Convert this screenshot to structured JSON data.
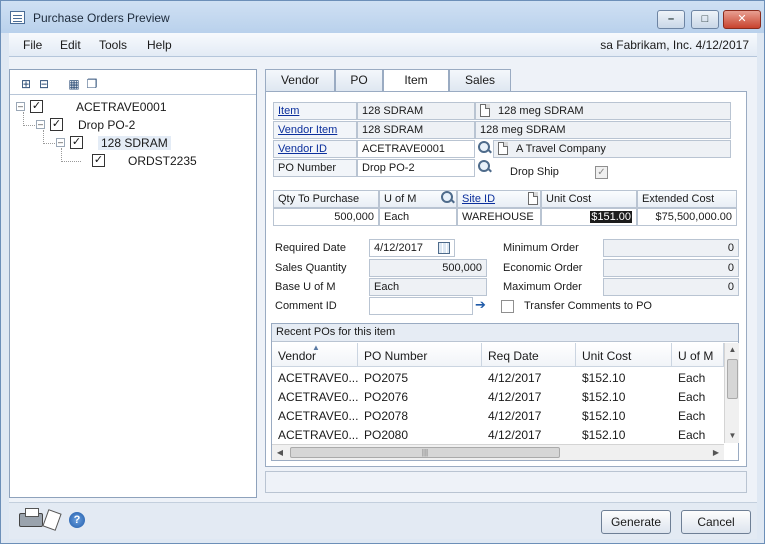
{
  "window": {
    "title": "Purchase Orders Preview"
  },
  "menu": {
    "items": [
      "File",
      "Edit",
      "Tools",
      "Help"
    ],
    "status": "sa  Fabrikam, Inc.  4/12/2017"
  },
  "tree": {
    "nodes": [
      {
        "label": "ACETRAVE0001",
        "checked": true
      },
      {
        "label": "Drop PO-2",
        "checked": true
      },
      {
        "label": "128 SDRAM",
        "checked": true
      },
      {
        "label": "ORDST2235",
        "checked": true
      }
    ]
  },
  "tabs": [
    "Vendor",
    "PO",
    "Item",
    "Sales"
  ],
  "active_tab": "Item",
  "item": {
    "item_label": "Item",
    "item_value": "128 SDRAM",
    "item_desc": "128 meg SDRAM",
    "vendor_item_label": "Vendor Item",
    "vendor_item_value": "128 SDRAM",
    "vendor_item_desc": "128 meg SDRAM",
    "vendor_id_label": "Vendor ID",
    "vendor_id_value": "ACETRAVE0001",
    "vendor_name": "A Travel Company",
    "po_number_label": "PO Number",
    "po_number_value": "Drop PO-2",
    "drop_ship_label": "Drop Ship",
    "drop_ship_checked": true
  },
  "qty_grid": {
    "headers": [
      "Qty To Purchase",
      "U of M",
      "Site ID",
      "Unit Cost",
      "Extended Cost"
    ],
    "values": [
      "500,000",
      "Each",
      "WAREHOUSE",
      "$151.00",
      "$75,500,000.00"
    ]
  },
  "details": {
    "required_date_label": "Required Date",
    "required_date_value": "4/12/2017",
    "sales_quantity_label": "Sales Quantity",
    "sales_quantity_value": "500,000",
    "base_uofm_label": "Base U of M",
    "base_uofm_value": "Each",
    "comment_id_label": "Comment ID",
    "comment_id_value": "",
    "minimum_order_label": "Minimum Order",
    "minimum_order_value": "0",
    "economic_order_label": "Economic Order",
    "economic_order_value": "0",
    "maximum_order_label": "Maximum Order",
    "maximum_order_value": "0",
    "transfer_comments_label": "Transfer Comments to PO"
  },
  "recent": {
    "caption": "Recent POs for this item",
    "headers": [
      "Vendor",
      "PO Number",
      "Req Date",
      "Unit Cost",
      "U of M"
    ],
    "rows": [
      [
        "ACETRAVE0...",
        "PO2075",
        "4/12/2017",
        "$152.10",
        "Each"
      ],
      [
        "ACETRAVE0...",
        "PO2076",
        "4/12/2017",
        "$152.10",
        "Each"
      ],
      [
        "ACETRAVE0...",
        "PO2078",
        "4/12/2017",
        "$152.10",
        "Each"
      ],
      [
        "ACETRAVE0...",
        "PO2080",
        "4/12/2017",
        "$152.10",
        "Each"
      ]
    ]
  },
  "footer": {
    "generate_label": "Generate",
    "cancel_label": "Cancel"
  },
  "icons": {
    "app": "window-icon",
    "tree_toolbar": [
      "expand-all-icon",
      "collapse-all-icon",
      "select-icon",
      "copy-icon"
    ],
    "lookup": "magnifier-icon",
    "note": "note-icon",
    "calendar": "calendar-icon",
    "arrow": "arrow-right-icon",
    "printer": "printer-icon",
    "help": "help-icon"
  },
  "colors": {
    "link": "#0b2f9c",
    "highlight": "#1c1c1c",
    "window_frame": "#6c8fb8"
  }
}
